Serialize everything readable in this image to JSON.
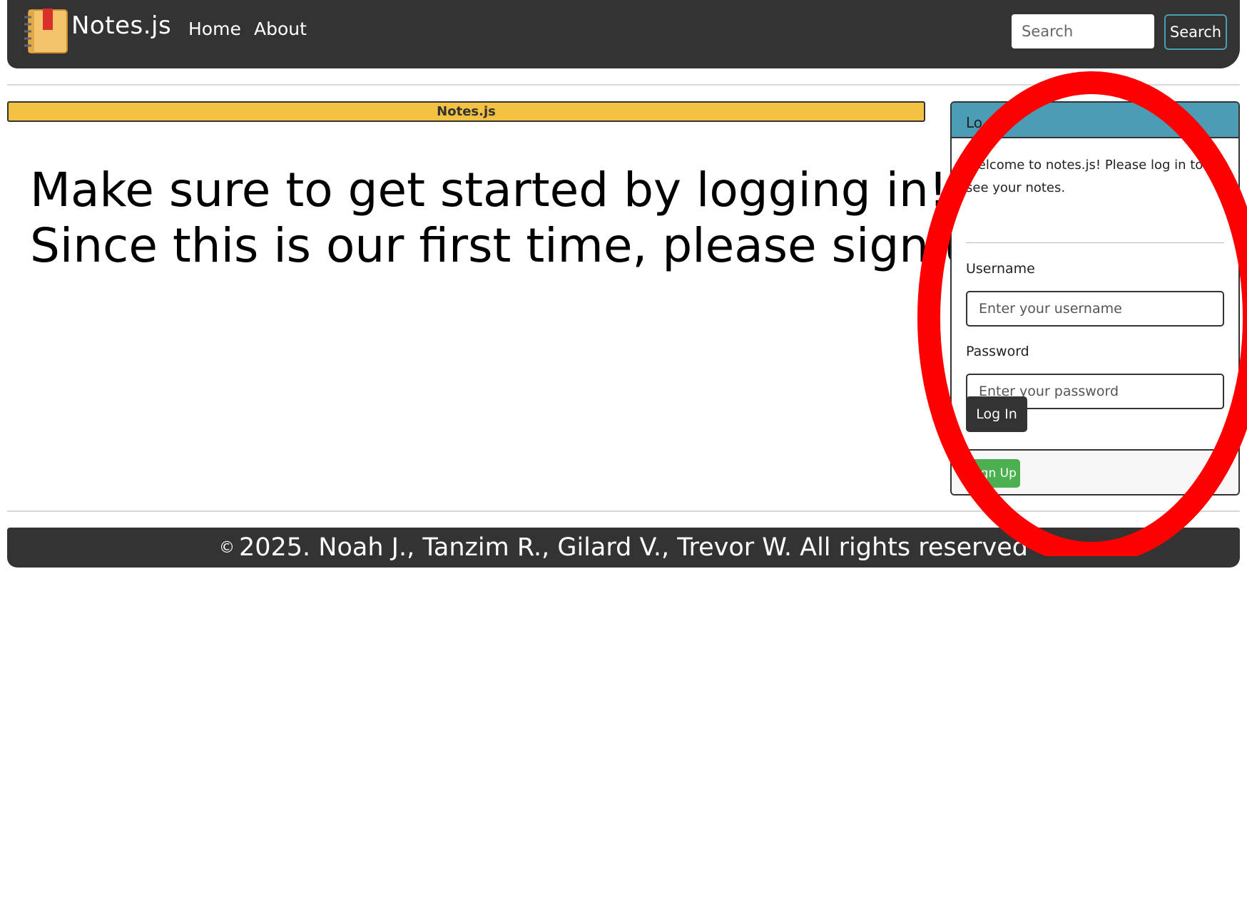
{
  "navbar": {
    "brand": "Notes.js",
    "links": [
      "Home",
      "About"
    ],
    "search_placeholder": "Search",
    "search_button": "Search"
  },
  "banner": {
    "text": "Notes.js"
  },
  "intro": {
    "line1": "Make sure to get started by logging in!",
    "line2": "Since this is our first time, please sign up!"
  },
  "login_card": {
    "header": "Lo",
    "welcome": "Welcome to notes.js! Please log in to see your notes.",
    "username_label": "Username",
    "username_placeholder": "Enter your username",
    "password_label": "Password",
    "password_placeholder": "Enter your password",
    "login_button": "Log In",
    "signup_button": "Sign Up"
  },
  "footer": {
    "copyright_symbol": "©",
    "text": "2025. Noah J., Tanzim R., Gilard V., Trevor W. All rights reserved"
  },
  "colors": {
    "navbar_bg": "#333333",
    "banner_bg": "#f4c242",
    "card_header_bg": "#4a9db5",
    "signup_bg": "#4caf50",
    "annotation": "#ff0000"
  },
  "icons": {
    "logo": "notebook-icon"
  }
}
